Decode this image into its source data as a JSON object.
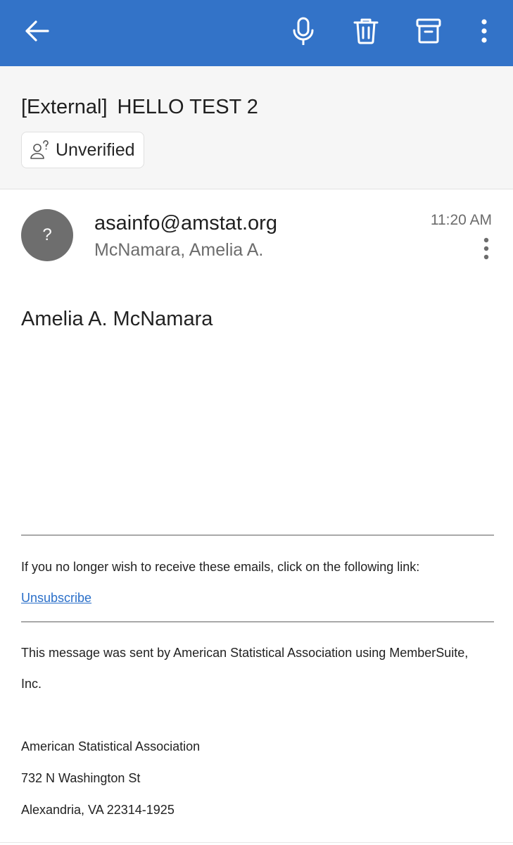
{
  "toolbar": {
    "background": "#3373c8",
    "icons": [
      "back-arrow-icon",
      "microphone-icon",
      "trash-icon",
      "archive-icon",
      "more-vertical-icon"
    ]
  },
  "subject": {
    "tag": "[External]",
    "title": "HELLO TEST 2"
  },
  "verification": {
    "icon": "unverified-person-icon",
    "label": "Unverified"
  },
  "sender": {
    "avatar_text": "?",
    "email": "asainfo@amstat.org",
    "to_name": "McNamara, Amelia A.",
    "time": "11:20 AM"
  },
  "body": {
    "greeting": "Amelia A. McNamara",
    "unsubscribe_prompt": "If you no longer wish to receive these emails, click on the following link:",
    "unsubscribe_link": "Unsubscribe",
    "sent_by_line1": "This message was sent by American Statistical Association using MemberSuite,",
    "sent_by_line2": "Inc.",
    "org_name": "American Statistical Association",
    "address_street": "732 N Washington St",
    "address_city": "Alexandria, VA 22314-1925"
  },
  "colors": {
    "accent": "#3373c8",
    "link": "#2a6fc9",
    "avatar": "#6e6e6e"
  }
}
